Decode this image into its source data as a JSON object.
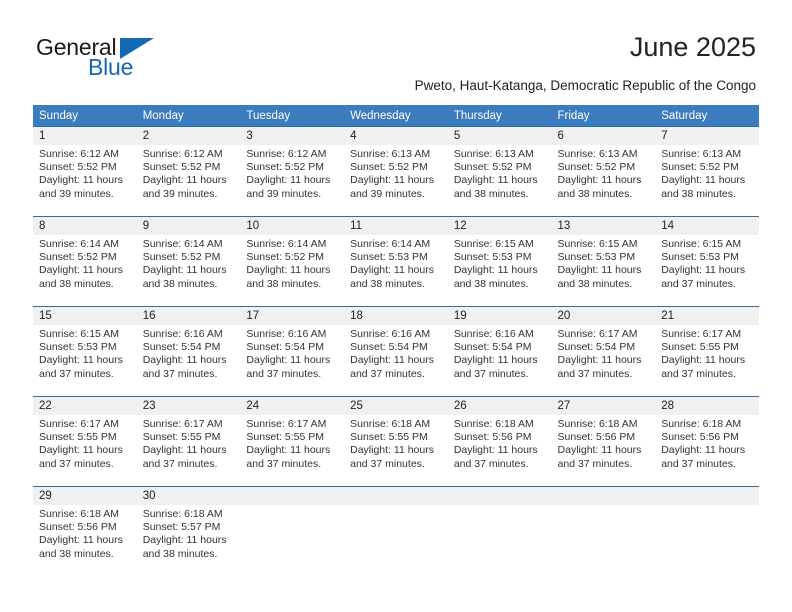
{
  "brand": {
    "name_part1": "General",
    "name_part2": "Blue",
    "accent_color": "#1268b3"
  },
  "header": {
    "title": "June 2025",
    "subtitle": "Pweto, Haut-Katanga, Democratic Republic of the Congo"
  },
  "calendar": {
    "header_color": "#3a7cbe",
    "daynum_band_color": "#f0f0f0",
    "weekday_headers": [
      "Sunday",
      "Monday",
      "Tuesday",
      "Wednesday",
      "Thursday",
      "Friday",
      "Saturday"
    ],
    "weeks": [
      [
        {
          "day": "1",
          "sunrise": "Sunrise: 6:12 AM",
          "sunset": "Sunset: 5:52 PM",
          "daylight_line1": "Daylight: 11 hours",
          "daylight_line2": "and 39 minutes."
        },
        {
          "day": "2",
          "sunrise": "Sunrise: 6:12 AM",
          "sunset": "Sunset: 5:52 PM",
          "daylight_line1": "Daylight: 11 hours",
          "daylight_line2": "and 39 minutes."
        },
        {
          "day": "3",
          "sunrise": "Sunrise: 6:12 AM",
          "sunset": "Sunset: 5:52 PM",
          "daylight_line1": "Daylight: 11 hours",
          "daylight_line2": "and 39 minutes."
        },
        {
          "day": "4",
          "sunrise": "Sunrise: 6:13 AM",
          "sunset": "Sunset: 5:52 PM",
          "daylight_line1": "Daylight: 11 hours",
          "daylight_line2": "and 39 minutes."
        },
        {
          "day": "5",
          "sunrise": "Sunrise: 6:13 AM",
          "sunset": "Sunset: 5:52 PM",
          "daylight_line1": "Daylight: 11 hours",
          "daylight_line2": "and 38 minutes."
        },
        {
          "day": "6",
          "sunrise": "Sunrise: 6:13 AM",
          "sunset": "Sunset: 5:52 PM",
          "daylight_line1": "Daylight: 11 hours",
          "daylight_line2": "and 38 minutes."
        },
        {
          "day": "7",
          "sunrise": "Sunrise: 6:13 AM",
          "sunset": "Sunset: 5:52 PM",
          "daylight_line1": "Daylight: 11 hours",
          "daylight_line2": "and 38 minutes."
        }
      ],
      [
        {
          "day": "8",
          "sunrise": "Sunrise: 6:14 AM",
          "sunset": "Sunset: 5:52 PM",
          "daylight_line1": "Daylight: 11 hours",
          "daylight_line2": "and 38 minutes."
        },
        {
          "day": "9",
          "sunrise": "Sunrise: 6:14 AM",
          "sunset": "Sunset: 5:52 PM",
          "daylight_line1": "Daylight: 11 hours",
          "daylight_line2": "and 38 minutes."
        },
        {
          "day": "10",
          "sunrise": "Sunrise: 6:14 AM",
          "sunset": "Sunset: 5:52 PM",
          "daylight_line1": "Daylight: 11 hours",
          "daylight_line2": "and 38 minutes."
        },
        {
          "day": "11",
          "sunrise": "Sunrise: 6:14 AM",
          "sunset": "Sunset: 5:53 PM",
          "daylight_line1": "Daylight: 11 hours",
          "daylight_line2": "and 38 minutes."
        },
        {
          "day": "12",
          "sunrise": "Sunrise: 6:15 AM",
          "sunset": "Sunset: 5:53 PM",
          "daylight_line1": "Daylight: 11 hours",
          "daylight_line2": "and 38 minutes."
        },
        {
          "day": "13",
          "sunrise": "Sunrise: 6:15 AM",
          "sunset": "Sunset: 5:53 PM",
          "daylight_line1": "Daylight: 11 hours",
          "daylight_line2": "and 38 minutes."
        },
        {
          "day": "14",
          "sunrise": "Sunrise: 6:15 AM",
          "sunset": "Sunset: 5:53 PM",
          "daylight_line1": "Daylight: 11 hours",
          "daylight_line2": "and 37 minutes."
        }
      ],
      [
        {
          "day": "15",
          "sunrise": "Sunrise: 6:15 AM",
          "sunset": "Sunset: 5:53 PM",
          "daylight_line1": "Daylight: 11 hours",
          "daylight_line2": "and 37 minutes."
        },
        {
          "day": "16",
          "sunrise": "Sunrise: 6:16 AM",
          "sunset": "Sunset: 5:54 PM",
          "daylight_line1": "Daylight: 11 hours",
          "daylight_line2": "and 37 minutes."
        },
        {
          "day": "17",
          "sunrise": "Sunrise: 6:16 AM",
          "sunset": "Sunset: 5:54 PM",
          "daylight_line1": "Daylight: 11 hours",
          "daylight_line2": "and 37 minutes."
        },
        {
          "day": "18",
          "sunrise": "Sunrise: 6:16 AM",
          "sunset": "Sunset: 5:54 PM",
          "daylight_line1": "Daylight: 11 hours",
          "daylight_line2": "and 37 minutes."
        },
        {
          "day": "19",
          "sunrise": "Sunrise: 6:16 AM",
          "sunset": "Sunset: 5:54 PM",
          "daylight_line1": "Daylight: 11 hours",
          "daylight_line2": "and 37 minutes."
        },
        {
          "day": "20",
          "sunrise": "Sunrise: 6:17 AM",
          "sunset": "Sunset: 5:54 PM",
          "daylight_line1": "Daylight: 11 hours",
          "daylight_line2": "and 37 minutes."
        },
        {
          "day": "21",
          "sunrise": "Sunrise: 6:17 AM",
          "sunset": "Sunset: 5:55 PM",
          "daylight_line1": "Daylight: 11 hours",
          "daylight_line2": "and 37 minutes."
        }
      ],
      [
        {
          "day": "22",
          "sunrise": "Sunrise: 6:17 AM",
          "sunset": "Sunset: 5:55 PM",
          "daylight_line1": "Daylight: 11 hours",
          "daylight_line2": "and 37 minutes."
        },
        {
          "day": "23",
          "sunrise": "Sunrise: 6:17 AM",
          "sunset": "Sunset: 5:55 PM",
          "daylight_line1": "Daylight: 11 hours",
          "daylight_line2": "and 37 minutes."
        },
        {
          "day": "24",
          "sunrise": "Sunrise: 6:17 AM",
          "sunset": "Sunset: 5:55 PM",
          "daylight_line1": "Daylight: 11 hours",
          "daylight_line2": "and 37 minutes."
        },
        {
          "day": "25",
          "sunrise": "Sunrise: 6:18 AM",
          "sunset": "Sunset: 5:55 PM",
          "daylight_line1": "Daylight: 11 hours",
          "daylight_line2": "and 37 minutes."
        },
        {
          "day": "26",
          "sunrise": "Sunrise: 6:18 AM",
          "sunset": "Sunset: 5:56 PM",
          "daylight_line1": "Daylight: 11 hours",
          "daylight_line2": "and 37 minutes."
        },
        {
          "day": "27",
          "sunrise": "Sunrise: 6:18 AM",
          "sunset": "Sunset: 5:56 PM",
          "daylight_line1": "Daylight: 11 hours",
          "daylight_line2": "and 37 minutes."
        },
        {
          "day": "28",
          "sunrise": "Sunrise: 6:18 AM",
          "sunset": "Sunset: 5:56 PM",
          "daylight_line1": "Daylight: 11 hours",
          "daylight_line2": "and 37 minutes."
        }
      ],
      [
        {
          "day": "29",
          "sunrise": "Sunrise: 6:18 AM",
          "sunset": "Sunset: 5:56 PM",
          "daylight_line1": "Daylight: 11 hours",
          "daylight_line2": "and 38 minutes."
        },
        {
          "day": "30",
          "sunrise": "Sunrise: 6:18 AM",
          "sunset": "Sunset: 5:57 PM",
          "daylight_line1": "Daylight: 11 hours",
          "daylight_line2": "and 38 minutes."
        },
        {
          "day": "",
          "sunrise": "",
          "sunset": "",
          "daylight_line1": "",
          "daylight_line2": ""
        },
        {
          "day": "",
          "sunrise": "",
          "sunset": "",
          "daylight_line1": "",
          "daylight_line2": ""
        },
        {
          "day": "",
          "sunrise": "",
          "sunset": "",
          "daylight_line1": "",
          "daylight_line2": ""
        },
        {
          "day": "",
          "sunrise": "",
          "sunset": "",
          "daylight_line1": "",
          "daylight_line2": ""
        },
        {
          "day": "",
          "sunrise": "",
          "sunset": "",
          "daylight_line1": "",
          "daylight_line2": ""
        }
      ]
    ]
  }
}
